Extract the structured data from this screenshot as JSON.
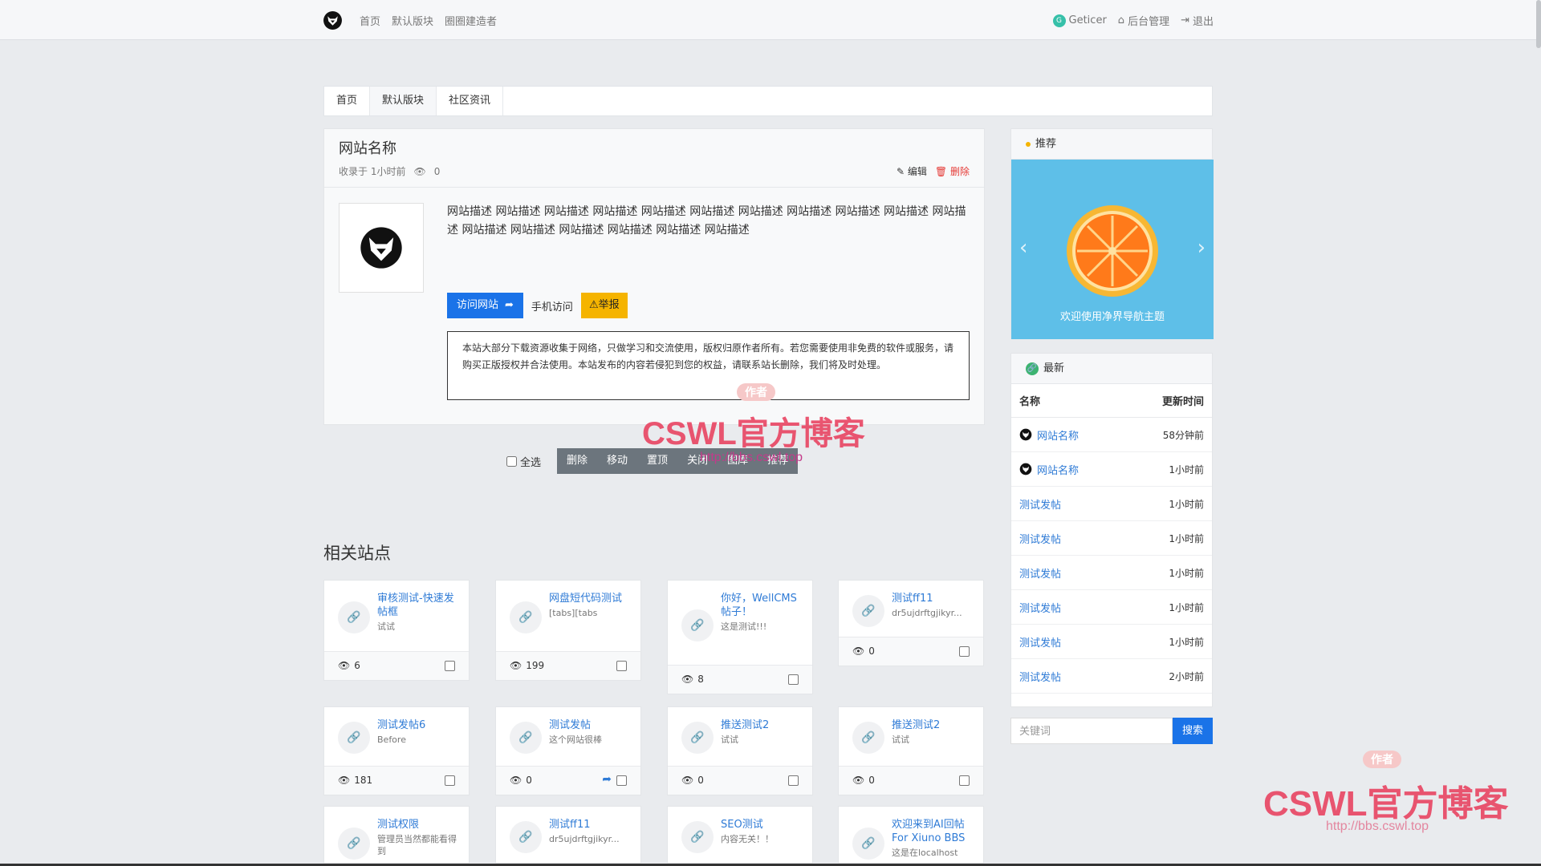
{
  "topnav": {
    "items": [
      "首页",
      "默认版块",
      "圈圈建造者"
    ]
  },
  "topright": {
    "user": "Geticer",
    "admin": "后台管理",
    "logout": "退出",
    "avatar_letter": "G"
  },
  "breadcrumb": [
    "首页",
    "默认版块",
    "社区资讯"
  ],
  "site": {
    "title": "网站名称",
    "collected": "收录于 1小时前",
    "views": "0",
    "edit": "编辑",
    "delete": "删除",
    "description": "网站描述 网站描述 网站描述 网站描述 网站描述 网站描述 网站描述 网站描述 网站描述 网站描述 网站描述 网站描述 网站描述 网站描述 网站描述 网站描述 网站描述",
    "visit": "访问网站",
    "mobile": "手机访问",
    "report": "举报",
    "notice": "本站大部分下载资源收集于网络，只做学习和交流使用，版权归原作者所有。若您需要使用非免费的软件或服务，请购买正版授权并合法使用。本站发布的内容若侵犯到您的权益，请联系站长删除，我们将及时处理。"
  },
  "batch": {
    "select_all": "全选",
    "actions": [
      "删除",
      "移动",
      "置顶",
      "关闭",
      "图库",
      "推荐"
    ]
  },
  "related": {
    "title": "相关站点",
    "cards": [
      {
        "title": "审核测试-快速发帖框",
        "sub": "试试",
        "views": "6"
      },
      {
        "title": "网盘短代码测试",
        "sub": "[tabs][tabs",
        "views": "199"
      },
      {
        "title": "你好，WellCMS帖子！",
        "sub": "这是测试!!!",
        "views": "8"
      },
      {
        "title": "测试ff11",
        "sub": "dr5ujdrftgjikyr...",
        "views": "0"
      },
      {
        "title": "测试发帖6",
        "sub": "Before",
        "views": "181"
      },
      {
        "title": "测试发帖",
        "sub": "这个网站很棒",
        "views": "0"
      },
      {
        "title": "推送测试2",
        "sub": "试试",
        "views": "0"
      },
      {
        "title": "推送测试2",
        "sub": "试试",
        "views": "0"
      },
      {
        "title": "测试权限",
        "sub": "管理员当然都能看得到"
      },
      {
        "title": "测试ff11",
        "sub": "dr5ujdrftgjikyr..."
      },
      {
        "title": "SEO测试",
        "sub": "内容无关！！"
      },
      {
        "title": "欢迎来到AI回帖 For Xiuno BBS",
        "sub": "这是在localhost"
      }
    ]
  },
  "sidebar": {
    "recommend_title": "推荐",
    "carousel_caption": "欢迎使用净界导航主题",
    "latest_title": "最新",
    "col_name": "名称",
    "col_time": "更新时间",
    "rows": [
      {
        "name": "网站名称",
        "time": "58分钟前"
      },
      {
        "name": "网站名称",
        "time": "1小时前"
      },
      {
        "name": "测试发帖",
        "time": "1小时前"
      },
      {
        "name": "测试发帖",
        "time": "1小时前"
      },
      {
        "name": "测试发帖",
        "time": "1小时前"
      },
      {
        "name": "测试发帖",
        "time": "1小时前"
      },
      {
        "name": "测试发帖",
        "time": "1小时前"
      },
      {
        "name": "测试发帖",
        "time": "2小时前"
      }
    ],
    "search_placeholder": "关键词",
    "search_button": "搜索"
  },
  "watermark": {
    "brand": "CSWL官方博客",
    "url": "http://bbs.cswl.top",
    "tag": "作者"
  },
  "colors": {
    "primary": "#1a73e8",
    "warning": "#f5b400",
    "danger": "#e53935",
    "carousel": "#5ebfe8"
  }
}
